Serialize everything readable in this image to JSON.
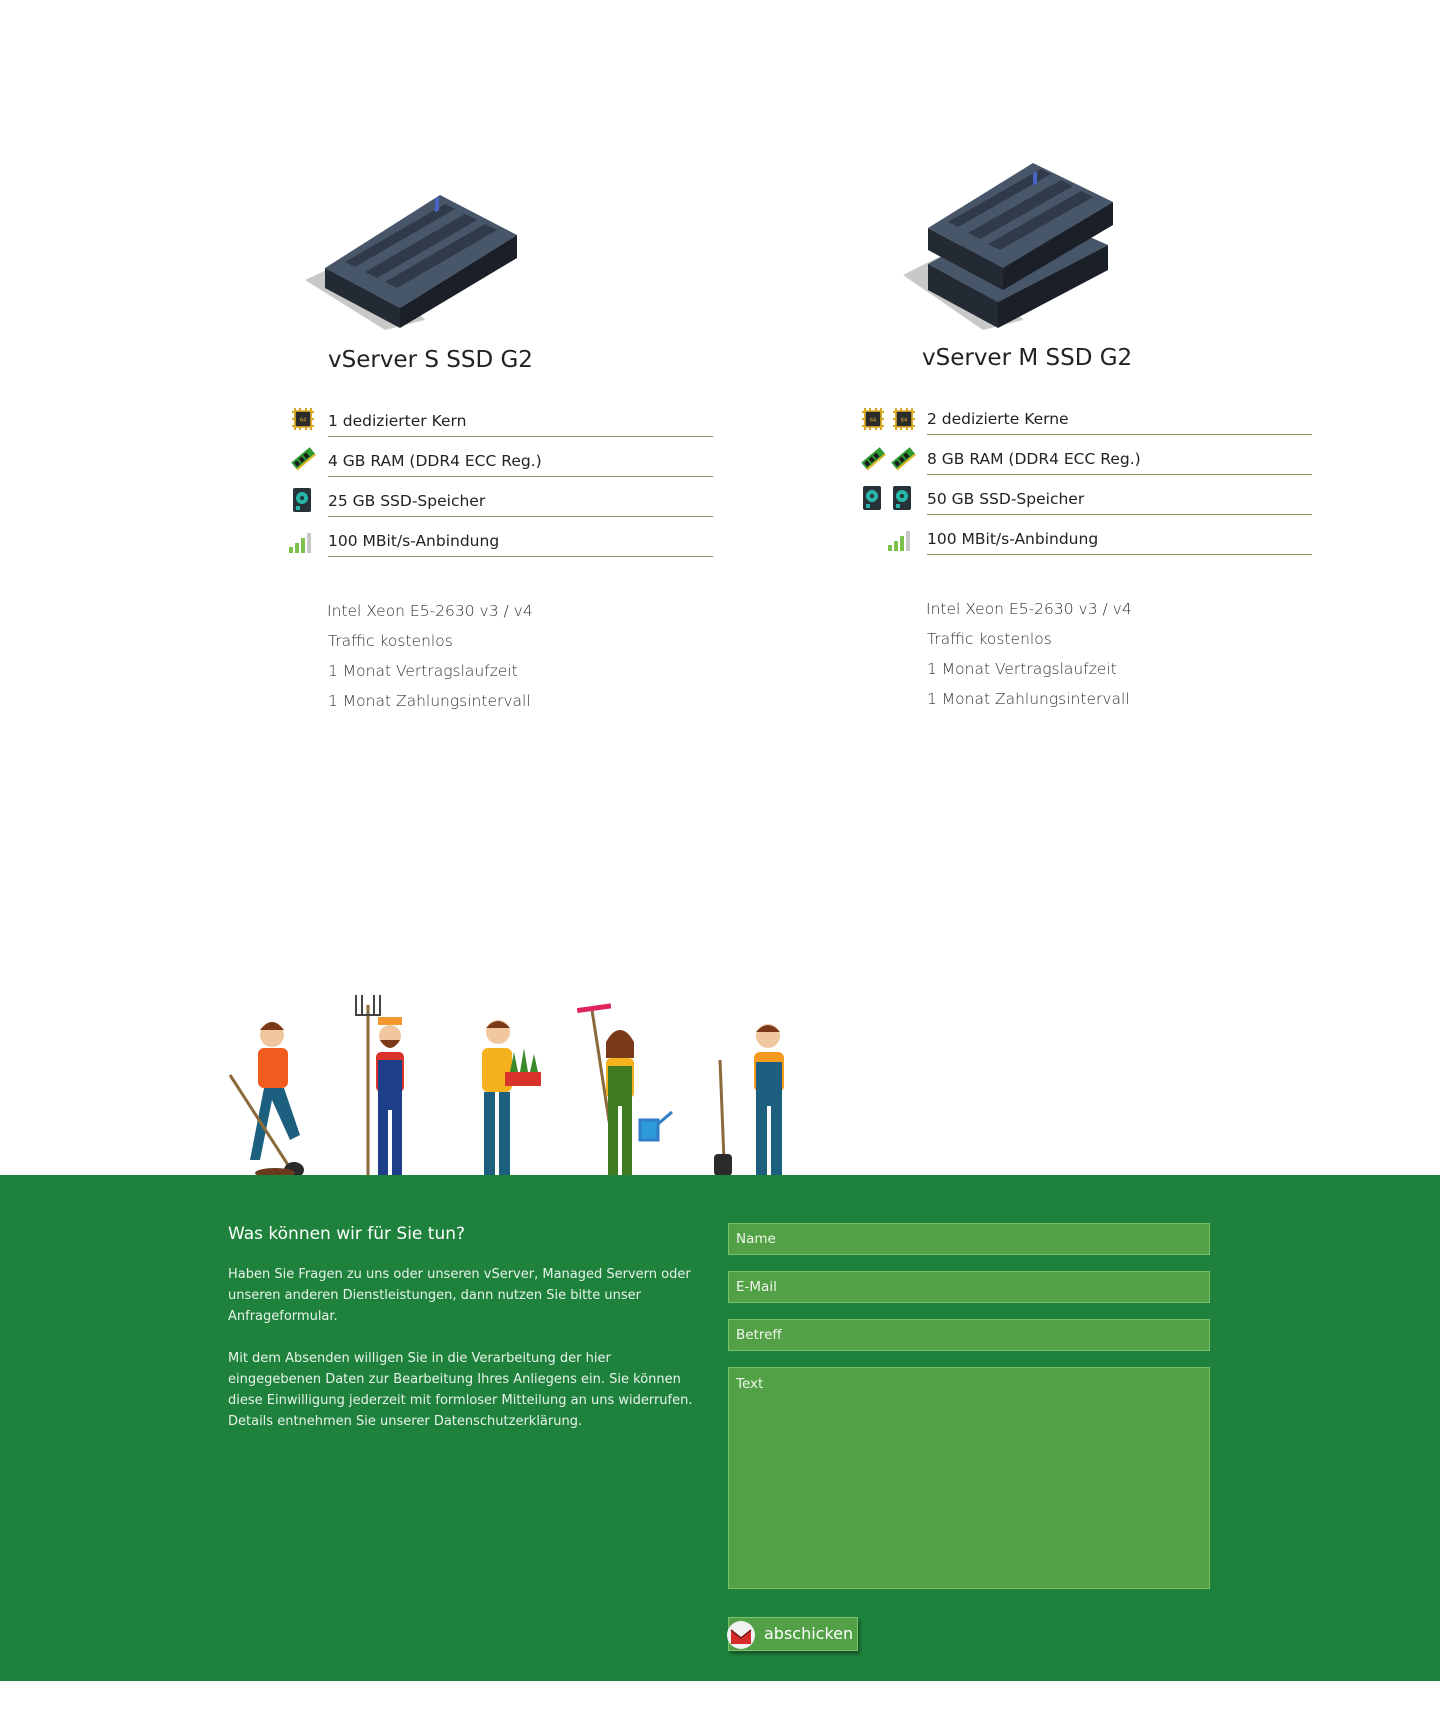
{
  "products": [
    {
      "title": "vServer S SSD G2",
      "specs": [
        {
          "icon": "cpu-chip-icon",
          "label": "1 dedizierter Kern"
        },
        {
          "icon": "ram-module-icon",
          "label": "4 GB RAM (DDR4 ECC Reg.)"
        },
        {
          "icon": "ssd-drive-icon",
          "label": "25 GB SSD-Speicher"
        },
        {
          "icon": "signal-bars-icon",
          "label": "100 MBit/s-Anbindung"
        }
      ],
      "features": [
        "Intel Xeon E5-2630 v3 / v4",
        "Traffic kostenlos",
        "1 Monat Vertragslaufzeit",
        "1 Monat Zahlungsintervall"
      ]
    },
    {
      "title": "vServer M SSD G2",
      "specs": [
        {
          "icon": "cpu-chip-icon",
          "label": "2 dedizierte Kerne"
        },
        {
          "icon": "ram-module-icon",
          "label": "8 GB RAM (DDR4 ECC Reg.)"
        },
        {
          "icon": "ssd-drive-icon",
          "label": "50 GB SSD-Speicher"
        },
        {
          "icon": "signal-bars-icon",
          "label": "100 MBit/s-Anbindung"
        }
      ],
      "features": [
        "Intel Xeon E5-2630 v3 / v4",
        "Traffic kostenlos",
        "1 Monat Vertragslaufzeit",
        "1 Monat Zahlungsintervall"
      ]
    }
  ],
  "contact": {
    "title": "Was können wir für Sie tun?",
    "paragraph1": "Haben Sie Fragen zu uns oder unseren vServer, Managed Servern oder unseren anderen Dienstleistungen, dann nutzen Sie bitte unser Anfrageformular.",
    "paragraph2": "Mit dem Absenden willigen Sie in die Verarbeitung der hier eingegebenen Daten zur Bearbeitung Ihres Anliegens ein. Sie können diese Einwilligung jederzeit mit formloser Mitteilung an uns widerrufen. Details entnehmen Sie unserer Datenschutzerklärung.",
    "fields": {
      "name_placeholder": "Name",
      "email_placeholder": "E-Mail",
      "subject_placeholder": "Betreff",
      "text_placeholder": "Text"
    },
    "submit_label": "abschicken"
  },
  "colors": {
    "band_green": "#1e823c",
    "field_green": "#53a146",
    "spec_rule": "#8a9a5b"
  }
}
